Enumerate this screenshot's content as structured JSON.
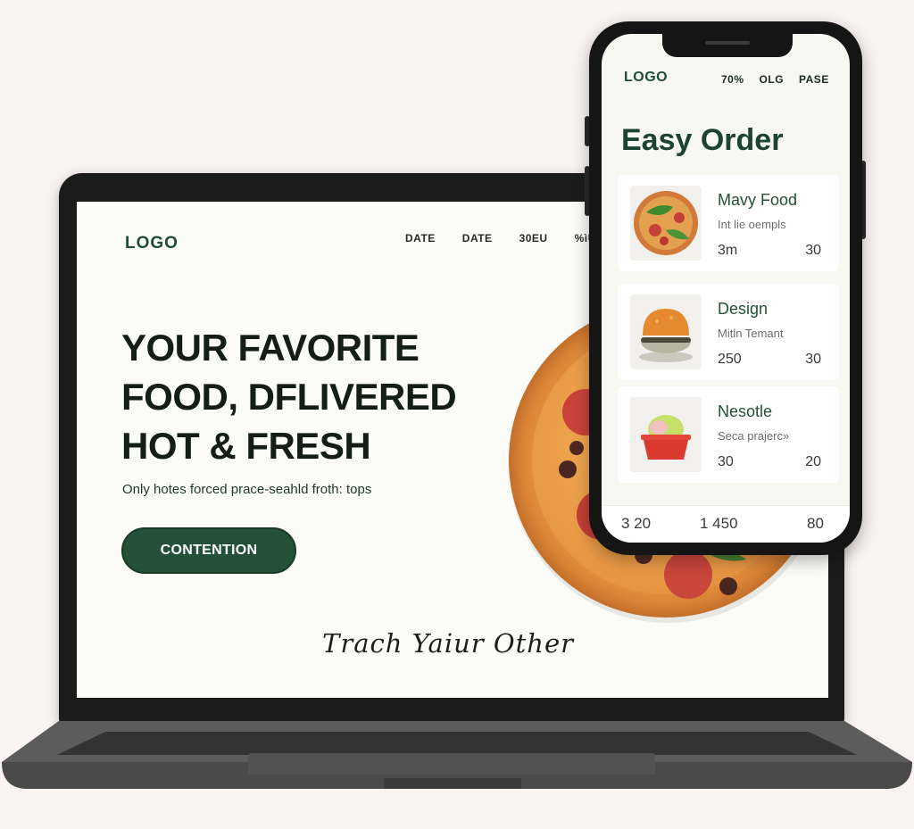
{
  "laptop": {
    "logo": "LOGO",
    "nav": [
      "DATE",
      "DATE",
      "30EU",
      "%ìU"
    ],
    "hero_lines": [
      "YOUR FAVORITE",
      "FOOD, DFLIVERED",
      "HOT & FRESH"
    ],
    "subtitle": "Only hotes forced prace-seahld froth: tops",
    "cta_label": "CONTENTION",
    "script_text": "Trach Yaiur Other"
  },
  "phone": {
    "logo": "LOGO",
    "nav": [
      "70%",
      "OLG",
      "PASE"
    ],
    "title": "Easy Order",
    "items": [
      {
        "name": "Mavy Food",
        "desc": "Int lie oempls",
        "left": "3m",
        "right": "30",
        "icon": "salad-pizza-icon"
      },
      {
        "name": "Design",
        "desc": "Mitln Temant",
        "left": "250",
        "right": "30",
        "icon": "burger-icon"
      },
      {
        "name": "Nesotle",
        "desc": "Seca prajerc»",
        "left": "30",
        "right": "20",
        "icon": "dessert-bowl-icon"
      }
    ],
    "footer": [
      "3 20",
      "1 450",
      "80"
    ]
  },
  "colors": {
    "brand_green": "#245038",
    "background": "#f9f3f1",
    "screen_bg": "#fbfbf8"
  }
}
